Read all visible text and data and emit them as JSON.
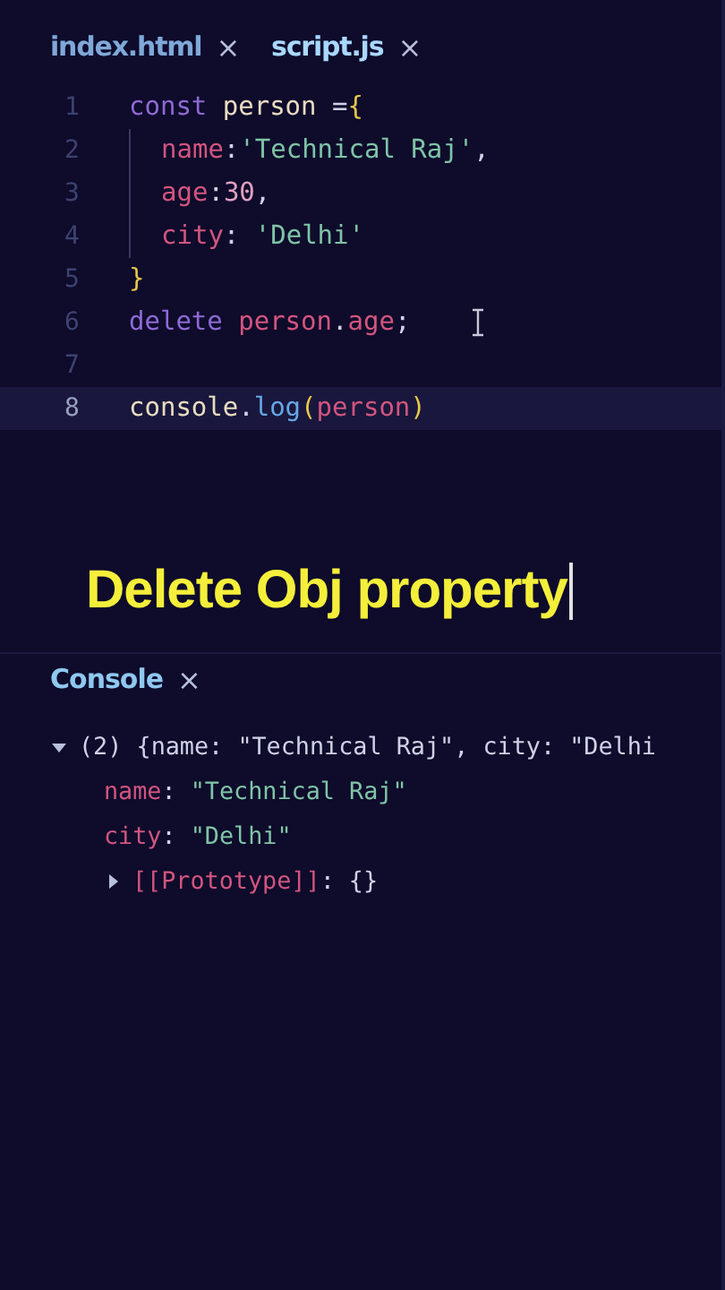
{
  "tabs": [
    {
      "label": "index.html",
      "selected": false,
      "close": "×"
    },
    {
      "label": "script.js",
      "selected": true,
      "close": "×"
    }
  ],
  "editor": {
    "lines": [
      {
        "number": "1",
        "indented": false,
        "active": false,
        "tokens": [
          {
            "text": "const ",
            "kind": "keyword"
          },
          {
            "text": "person ",
            "kind": "variable"
          },
          {
            "text": "=",
            "kind": "punct"
          },
          {
            "text": "{",
            "kind": "bracket"
          }
        ]
      },
      {
        "number": "2",
        "indented": true,
        "active": false,
        "tokens": [
          {
            "text": "name",
            "kind": "property"
          },
          {
            "text": ":",
            "kind": "punct"
          },
          {
            "text": "'Technical Raj'",
            "kind": "string"
          },
          {
            "text": ",",
            "kind": "punct"
          }
        ]
      },
      {
        "number": "3",
        "indented": true,
        "active": false,
        "tokens": [
          {
            "text": "age",
            "kind": "property"
          },
          {
            "text": ":",
            "kind": "punct"
          },
          {
            "text": "30",
            "kind": "number"
          },
          {
            "text": ",",
            "kind": "punct"
          }
        ]
      },
      {
        "number": "4",
        "indented": true,
        "active": false,
        "tokens": [
          {
            "text": "city",
            "kind": "property"
          },
          {
            "text": ": ",
            "kind": "punct"
          },
          {
            "text": "'Delhi'",
            "kind": "string"
          }
        ]
      },
      {
        "number": "5",
        "indented": false,
        "active": false,
        "tokens": [
          {
            "text": "}",
            "kind": "bracket"
          }
        ]
      },
      {
        "number": "6",
        "indented": false,
        "active": false,
        "tokens": [
          {
            "text": "delete ",
            "kind": "keyword"
          },
          {
            "text": "person",
            "kind": "property"
          },
          {
            "text": ".",
            "kind": "punct"
          },
          {
            "text": "age",
            "kind": "property"
          },
          {
            "text": ";",
            "kind": "punct"
          }
        ]
      },
      {
        "number": "7",
        "indented": false,
        "active": false
      },
      {
        "number": "8",
        "indented": false,
        "active": true,
        "tokens": [
          {
            "text": "console",
            "kind": "variable"
          },
          {
            "text": ".",
            "kind": "punct"
          },
          {
            "text": "log",
            "kind": "function"
          },
          {
            "text": "(",
            "kind": "bracket"
          },
          {
            "text": "person",
            "kind": "property"
          },
          {
            "text": ")",
            "kind": "bracket"
          }
        ]
      }
    ]
  },
  "title": "Delete Obj property",
  "console": {
    "label": "Console",
    "close": "×",
    "lines": [
      {
        "kind": "summary",
        "expanded": true,
        "tokens": [
          {
            "text": "(2) {",
            "kind": "punct"
          },
          {
            "text": "name: ",
            "kind": "punct"
          },
          {
            "text": "\"Technical Raj\"",
            "kind": "punct"
          },
          {
            "text": ", city: ",
            "kind": "punct"
          },
          {
            "text": "\"Delhi",
            "kind": "punct"
          }
        ]
      },
      {
        "kind": "property",
        "tokens": [
          {
            "text": "name",
            "kind": "property"
          },
          {
            "text": ": ",
            "kind": "punct"
          },
          {
            "text": "\"Technical Raj\"",
            "kind": "string"
          }
        ]
      },
      {
        "kind": "property",
        "tokens": [
          {
            "text": "city",
            "kind": "property"
          },
          {
            "text": ": ",
            "kind": "punct"
          },
          {
            "text": "\"Delhi\"",
            "kind": "string"
          }
        ]
      },
      {
        "kind": "prototype",
        "expanded": false,
        "tokens": [
          {
            "text": "[[Prototype]]",
            "kind": "property"
          },
          {
            "text": ": {}",
            "kind": "punct"
          }
        ]
      }
    ]
  }
}
